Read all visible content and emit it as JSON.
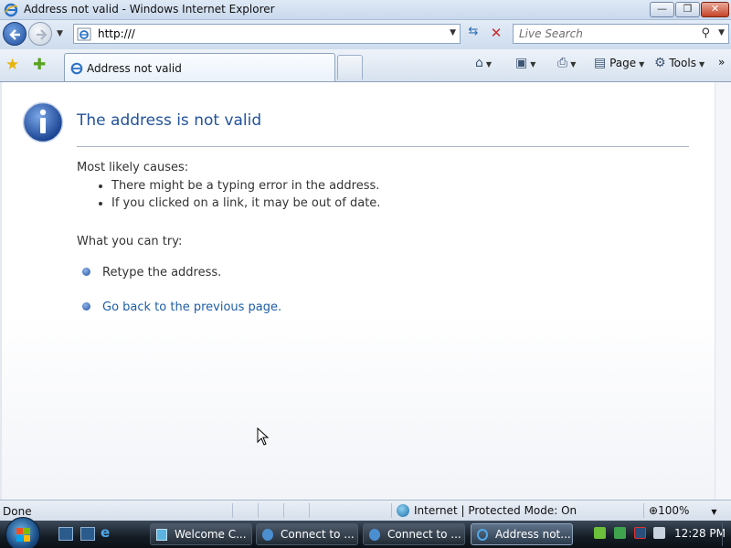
{
  "window": {
    "title": "Address not valid - Windows Internet Explorer",
    "controls": {
      "minimize": "—",
      "maximize": "❐",
      "close": "✕"
    }
  },
  "navbar": {
    "address": "http:///",
    "search_placeholder": "Live Search"
  },
  "tabbar": {
    "tab_label": "Address not valid",
    "commands": {
      "page": "Page",
      "tools": "Tools"
    }
  },
  "content": {
    "heading": "The address is not valid",
    "causes_label": "Most likely causes:",
    "causes": [
      "There might be a typing error in the address.",
      "If you clicked on a link, it may be out of date."
    ],
    "try_label": "What you can try:",
    "try_items": [
      "Retype the address.",
      "Go back to the previous page."
    ]
  },
  "status": {
    "text": "Done",
    "zone": "Internet | Protected Mode: On",
    "zoom": "100%"
  },
  "taskbar": {
    "tasks": [
      {
        "label": "Welcome C..."
      },
      {
        "label": "Connect to ..."
      },
      {
        "label": "Connect to ..."
      },
      {
        "label": "Address not..."
      }
    ],
    "clock": "12:28 PM"
  },
  "colors": {
    "heading": "#22529a",
    "link": "#1d5ea8",
    "close_button": "#c44327",
    "taskbar": "#141c25"
  },
  "icons": [
    "ie-icon",
    "back-arrow-icon",
    "forward-arrow-icon",
    "refresh-icon",
    "stop-icon",
    "search-icon",
    "favorites-star-icon",
    "add-favorites-icon",
    "home-icon",
    "feeds-icon",
    "print-icon",
    "page-icon",
    "tools-gear-icon",
    "info-icon",
    "globe-icon",
    "zoom-icon",
    "windows-flag-icon"
  ]
}
